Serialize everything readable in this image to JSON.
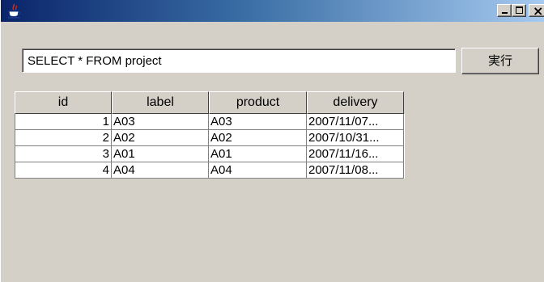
{
  "window": {
    "minimize_glyph": "_",
    "close_glyph": "×"
  },
  "query": {
    "value": "SELECT * FROM project",
    "run_label": "実行"
  },
  "table": {
    "headers": [
      "id",
      "label",
      "product",
      "delivery"
    ],
    "rows": [
      [
        "1",
        "A03",
        "A03",
        "2007/11/07..."
      ],
      [
        "2",
        "A02",
        "A02",
        "2007/10/31..."
      ],
      [
        "3",
        "A01",
        "A01",
        "2007/11/16..."
      ],
      [
        "4",
        "A04",
        "A04",
        "2007/11/08..."
      ]
    ]
  },
  "icons": {
    "app": "java-coffee-cup-icon",
    "minimize": "minimize-icon",
    "maximize": "maximize-icon",
    "close": "close-icon"
  }
}
